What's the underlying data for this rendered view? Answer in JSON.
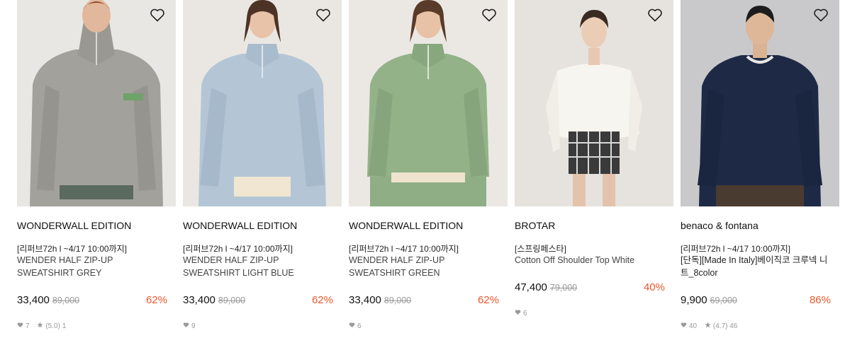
{
  "products": [
    {
      "brand": "WONDERWALL EDITION",
      "promo": "[리퍼브72h l ~4/17 10:00까지]",
      "name": "WENDER HALF ZIP-UP SWEATSHIRT GREY",
      "price": "33,400",
      "original_price": "89,000",
      "discount": "62%",
      "likes": "7",
      "rating": "(5.0)",
      "reviews": "1",
      "image": "model-grey-half-zip-sweatshirt",
      "colors": {
        "bg": "#e9e7e3",
        "garment": "#a3a19c"
      }
    },
    {
      "brand": "WONDERWALL EDITION",
      "promo": "[리퍼브72h l ~4/17 10:00까지]",
      "name": "WENDER HALF ZIP-UP SWEATSHIRT LIGHT BLUE",
      "price": "33,400",
      "original_price": "89,000",
      "discount": "62%",
      "likes": "9",
      "image": "model-light-blue-half-zip-sweatshirt",
      "colors": {
        "bg": "#eae7e2",
        "garment": "#b4c6d6"
      }
    },
    {
      "brand": "WONDERWALL EDITION",
      "promo": "[리퍼브72h l ~4/17 10:00까지]",
      "name": "WENDER HALF ZIP-UP SWEATSHIRT GREEN",
      "price": "33,400",
      "original_price": "89,000",
      "discount": "62%",
      "likes": "6",
      "image": "model-green-half-zip-sweatshirt",
      "colors": {
        "bg": "#ebe8e3",
        "garment": "#93b288"
      }
    },
    {
      "brand": "BROTAR",
      "promo": "[스프링페스타]",
      "name": "Cotton Off Shoulder Top White",
      "price": "47,400",
      "original_price": "79,000",
      "discount": "40%",
      "likes": "6",
      "image": "model-white-off-shoulder-top",
      "colors": {
        "bg": "#e6e3df",
        "garment": "#f7f5f0"
      }
    },
    {
      "brand": "benaco & fontana",
      "promo": "[리퍼브72h l ~4/17 10:00까지]",
      "name": "[단독][Made In Italy]베이직코 크루넥 니트_8color",
      "price": "9,900",
      "original_price": "69,000",
      "discount": "86%",
      "likes": "40",
      "rating": "(4.7)",
      "reviews": "46",
      "image": "model-navy-crew-neck-knit",
      "colors": {
        "bg": "#c9c9cb",
        "garment": "#1e2a45"
      }
    }
  ],
  "colors": {
    "discount": "#e8582c",
    "text": "#222222",
    "muted": "#999999"
  }
}
